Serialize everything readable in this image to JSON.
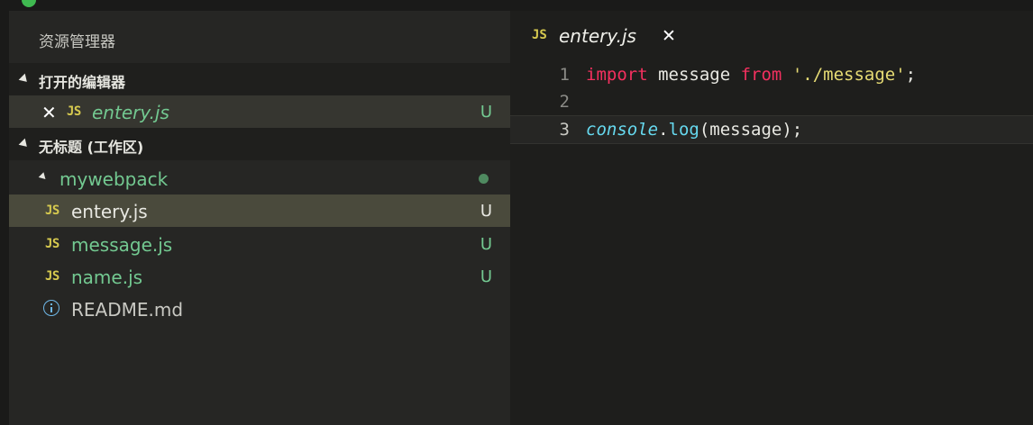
{
  "colors": {
    "accent_green": "#73c991",
    "js_icon_yellow": "#d6c94f",
    "keyword_pink": "#f4305f",
    "string_yellow": "#e6db74",
    "builtin_cyan": "#66d9ef",
    "info_blue": "#6fb8e8"
  },
  "sidebar": {
    "title": "资源管理器",
    "open_editors": {
      "label": "打开的编辑器",
      "items": [
        {
          "icon": "js-icon",
          "icon_text": "JS",
          "close_icon": "close-icon",
          "close_glyph": "✕",
          "name": "entery.js",
          "status": "U"
        }
      ]
    },
    "workspace": {
      "label": "无标题 (工作区)",
      "folder": {
        "name": "mywebpack",
        "modified_indicator": "dot"
      },
      "files": [
        {
          "icon": "js-icon",
          "icon_text": "JS",
          "name": "entery.js",
          "status": "U"
        },
        {
          "icon": "js-icon",
          "icon_text": "JS",
          "name": "message.js",
          "status": "U"
        },
        {
          "icon": "js-icon",
          "icon_text": "JS",
          "name": "name.js",
          "status": "U"
        },
        {
          "icon": "info-icon",
          "icon_text": "",
          "name": "README.md",
          "status": ""
        }
      ]
    }
  },
  "editor": {
    "tab": {
      "icon_text": "JS",
      "name": "entery.js",
      "close_glyph": "✕"
    },
    "lines": [
      {
        "number": "1",
        "tokens": [
          {
            "t": "import",
            "c": "kw"
          },
          {
            "t": " message ",
            "c": ""
          },
          {
            "t": "from",
            "c": "kw"
          },
          {
            "t": " ",
            "c": ""
          },
          {
            "t": "'./message'",
            "c": "str"
          },
          {
            "t": ";",
            "c": "punc"
          }
        ]
      },
      {
        "number": "2",
        "tokens": []
      },
      {
        "number": "3",
        "tokens": [
          {
            "t": "console",
            "c": "cls"
          },
          {
            "t": ".",
            "c": "punc"
          },
          {
            "t": "log",
            "c": "fn"
          },
          {
            "t": "(message);",
            "c": "punc"
          }
        ]
      }
    ]
  }
}
